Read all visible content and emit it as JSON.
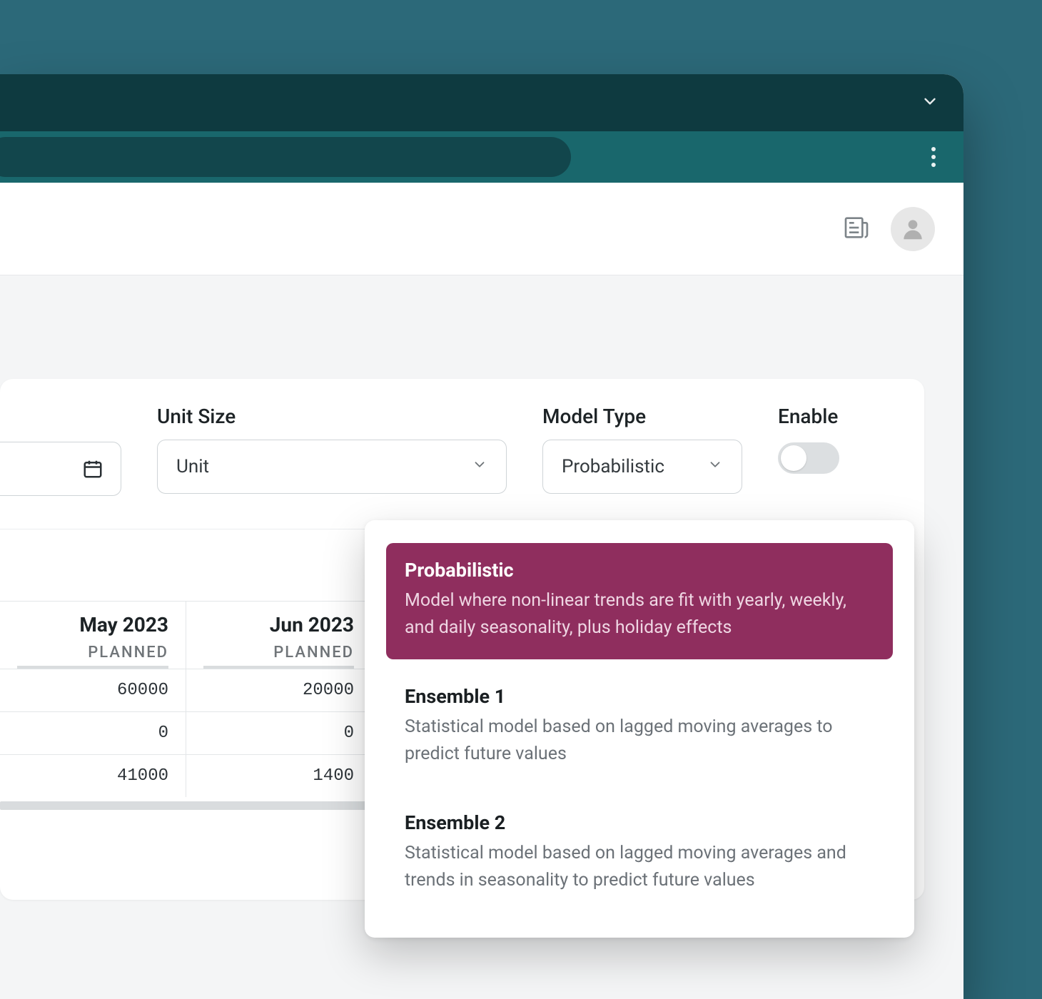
{
  "filters": {
    "unit_size": {
      "label": "Unit Size",
      "value": "Unit"
    },
    "model_type": {
      "label": "Model Type",
      "value": "Probabilistic"
    },
    "enable": {
      "label": "Enable",
      "on": false
    }
  },
  "model_dropdown": {
    "options": [
      {
        "name": "Probabilistic",
        "desc": "Model where non-linear trends are fit with yearly, weekly, and daily seasonality, plus holiday effects",
        "selected": true
      },
      {
        "name": "Ensemble 1",
        "desc": "Statistical model based on lagged moving averages to predict future values",
        "selected": false
      },
      {
        "name": "Ensemble 2",
        "desc": "Statistical model based on lagged moving averages and trends in seasonality to predict future values",
        "selected": false
      }
    ]
  },
  "table": {
    "column_sublabel": "PLANNED",
    "columns": [
      "May 2023",
      "Jun 2023",
      ""
    ],
    "rows": [
      [
        "60000",
        "20000",
        ""
      ],
      [
        "0",
        "0",
        ""
      ],
      [
        "41000",
        "1400",
        ""
      ]
    ]
  }
}
